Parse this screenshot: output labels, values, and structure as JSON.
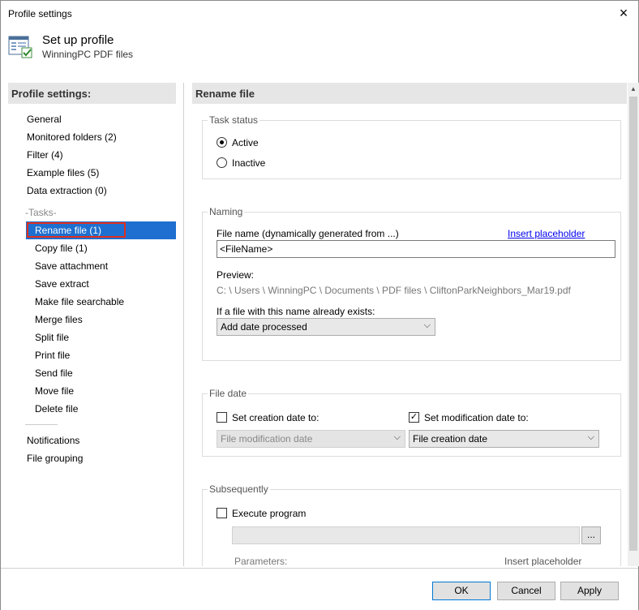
{
  "window": {
    "title": "Profile settings"
  },
  "header": {
    "title": "Set up profile",
    "subtitle": "WinningPC PDF files"
  },
  "left": {
    "heading": "Profile settings:",
    "items": [
      "General",
      "Monitored folders (2)",
      "Filter (4)",
      "Example files (5)",
      "Data extraction (0)"
    ],
    "tasks_label": "-Tasks-",
    "tasks": [
      "Rename file (1)",
      "Copy file (1)",
      "Save attachment",
      "Save extract",
      "Make file searchable",
      "Merge files",
      "Split file",
      "Print file",
      "Send file",
      "Move file",
      "Delete file"
    ],
    "bottom_items": [
      "Notifications",
      "File grouping"
    ]
  },
  "content": {
    "heading": "Rename file",
    "task_status": {
      "legend": "Task status",
      "active": "Active",
      "inactive": "Inactive"
    },
    "naming": {
      "legend": "Naming",
      "file_name_label": "File name (dynamically generated from ...)",
      "insert_placeholder": "Insert placeholder",
      "file_name_value": "<FileName>",
      "preview_label": "Preview:",
      "preview_value": "C: \\ Users \\ WinningPC \\ Documents \\ PDF files \\ CliftonParkNeighbors_Mar19.pdf",
      "exists_label": "If a file with this name already exists:",
      "exists_value": "Add date processed"
    },
    "file_date": {
      "legend": "File date",
      "set_creation": "Set creation date to:",
      "creation_value": "File modification date",
      "set_modification": "Set modification date to:",
      "modification_value": "File creation date"
    },
    "subsequently": {
      "legend": "Subsequently",
      "execute_program": "Execute program",
      "browse": "...",
      "parameters": "Parameters:",
      "insert_placeholder": "Insert placeholder"
    }
  },
  "footer": {
    "ok": "OK",
    "cancel": "Cancel",
    "apply": "Apply"
  },
  "icons": {
    "close": "×",
    "arrow": "⌵",
    "check": "✓",
    "up": "▲"
  }
}
